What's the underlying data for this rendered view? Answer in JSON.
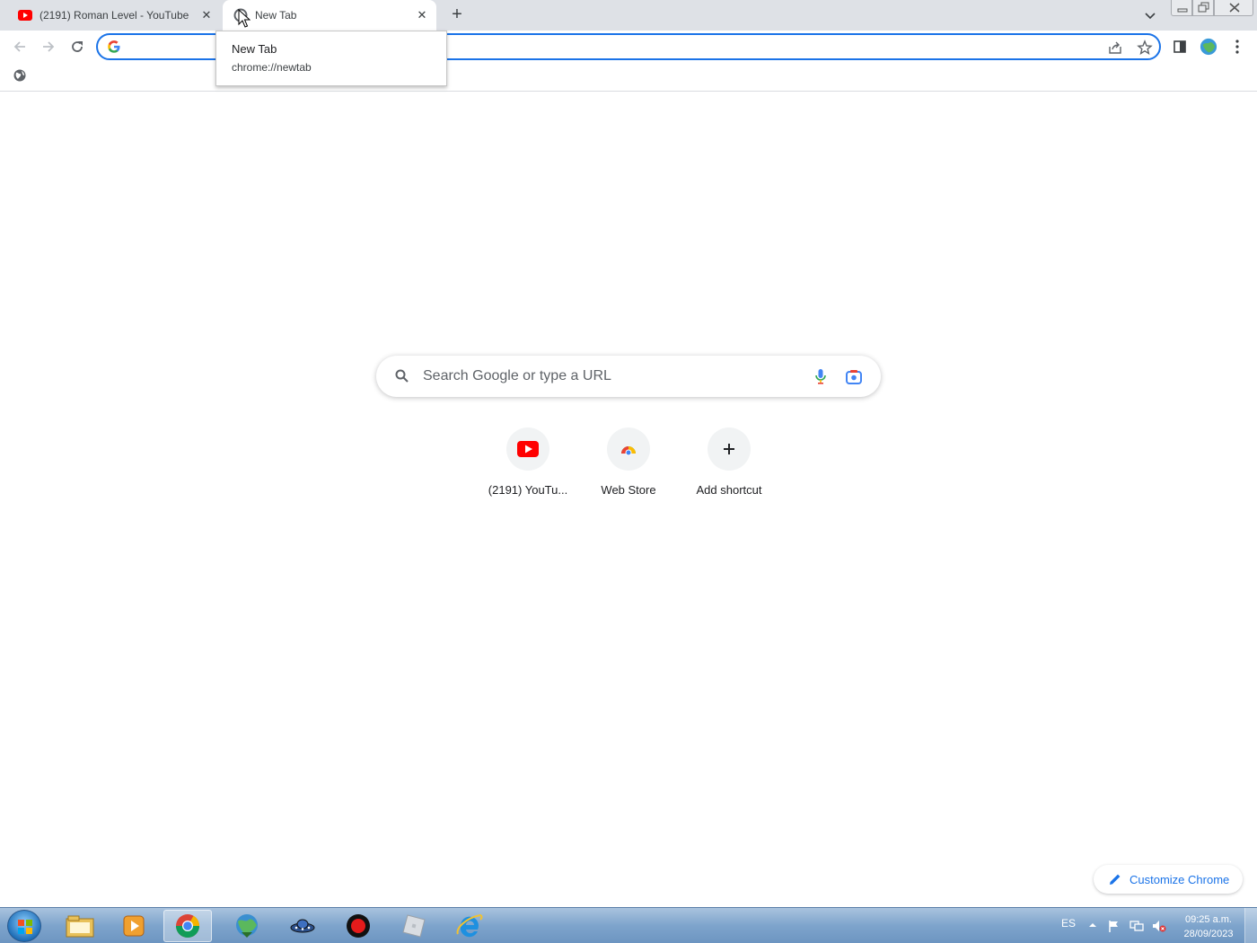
{
  "browser": {
    "tabs": [
      {
        "title": "(2191) Roman Level - YouTube",
        "favicon": "youtube-icon"
      },
      {
        "title": "New Tab",
        "favicon": "chrome-newtab-icon"
      }
    ],
    "hovercard": {
      "title": "New Tab",
      "url": "chrome://newtab"
    },
    "omnibox": {
      "value": ""
    }
  },
  "ntp": {
    "search_placeholder": "Search Google or type a URL",
    "shortcuts": [
      {
        "label": "(2191) YouTu...",
        "icon": "youtube-icon"
      },
      {
        "label": "Web Store",
        "icon": "web-store-icon"
      },
      {
        "label": "Add shortcut",
        "icon": "plus-icon"
      }
    ],
    "customize_label": "Customize Chrome"
  },
  "taskbar": {
    "language": "ES",
    "time": "09:25 a.m.",
    "date": "28/09/2023",
    "apps": [
      "file-explorer",
      "media-player",
      "chrome",
      "internet-download-manager",
      "ufo-app",
      "recorder",
      "roblox",
      "internet-explorer"
    ]
  },
  "colors": {
    "accent": "#1a73e8",
    "youtube": "#ff0000",
    "tabstrip": "#dee1e6"
  }
}
